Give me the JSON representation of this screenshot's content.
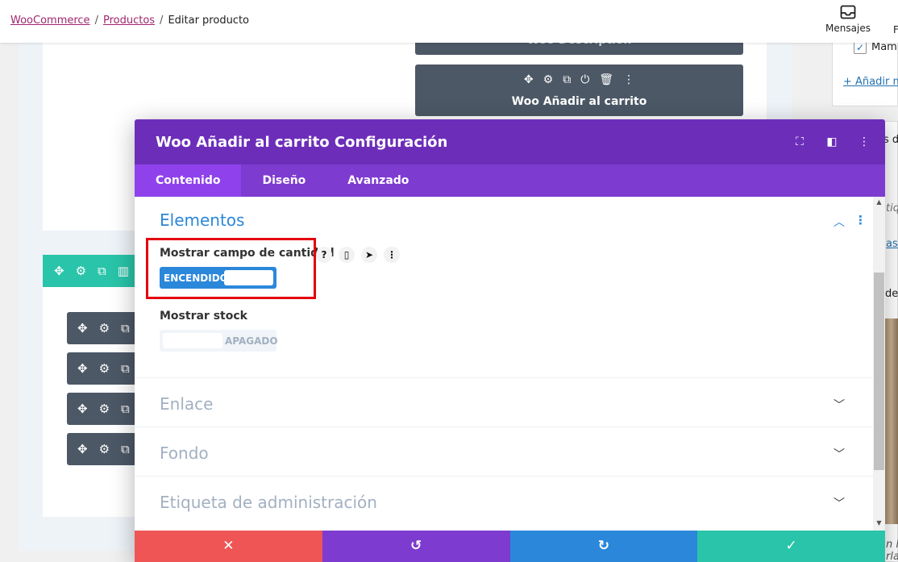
{
  "breadcrumb": {
    "items": [
      "WooCommerce",
      "Productos"
    ],
    "current": "Editar producto"
  },
  "topbar": {
    "messages_label": "Mensajes",
    "cut_label": "F"
  },
  "builder": {
    "module_behind": "Woo Description",
    "module_active": "Woo Añadir al carrito",
    "module_icons": [
      "move-icon",
      "gear-icon",
      "duplicate-icon",
      "power-icon",
      "trash-icon",
      "more-icon"
    ]
  },
  "sidebar": {
    "checkbox_label": "Mamp",
    "add_link": "+ Añadir nu",
    "snippets": [
      "s d",
      "tiq",
      "as d",
      "del",
      "n l",
      "rla"
    ]
  },
  "modal": {
    "title": "Woo Añadir al carrito Configuración",
    "header_icons": [
      "fullscreen-icon",
      "sidebar-icon",
      "more-icon"
    ],
    "tabs": [
      {
        "label": "Contenido",
        "active": true
      },
      {
        "label": "Diseño",
        "active": false
      },
      {
        "label": "Avanzado",
        "active": false
      }
    ],
    "sections": {
      "open": "Elementos",
      "closed": [
        "Enlace",
        "Fondo",
        "Etiqueta de administración"
      ]
    },
    "fields": {
      "quantity": {
        "label": "Mostrar campo de cantidad",
        "state": "ENCENDIDO",
        "icons": [
          "?",
          "mobile",
          "cursor",
          "more"
        ]
      },
      "stock": {
        "label": "Mostrar stock",
        "state": "APAGADO"
      }
    },
    "footer": [
      "cancel-icon",
      "undo-icon",
      "redo-icon",
      "save-icon"
    ]
  },
  "colors": {
    "purple_header": "#6c2eb9",
    "purple_tabs": "#7e3bd0",
    "blue": "#2b87da",
    "red": "#ef5555",
    "teal": "#29c4a9",
    "highlight": "#e3000f"
  }
}
